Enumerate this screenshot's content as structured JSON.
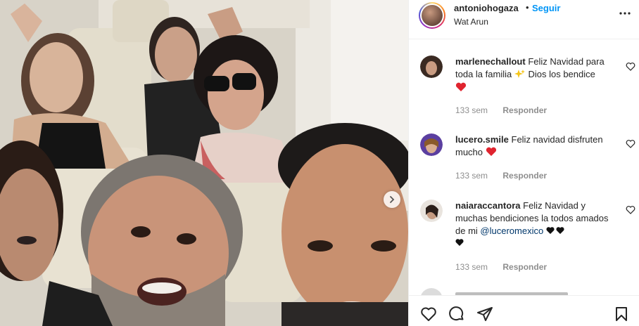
{
  "header": {
    "username": "antoniohogaza",
    "separator": "•",
    "follow_label": "Seguir",
    "location": "Wat Arun"
  },
  "comments": [
    {
      "username": "marlenechallout",
      "text": "Feliz Navidad para toda la familia",
      "emoji_text": "Dios los bendice",
      "time": "133 sem",
      "reply_label": "Responder"
    },
    {
      "username": "lucero.smile",
      "text": "Feliz navidad disfruten mucho",
      "time": "133 sem",
      "reply_label": "Responder"
    },
    {
      "username": "naiaraccantora",
      "text": "Feliz Navidad y muchas bendiciones la todos amados de mi",
      "mention": "@luceromexico",
      "time": "133 sem",
      "reply_label": "Responder"
    }
  ],
  "icons": {
    "more": "more-options-icon",
    "like": "heart-icon",
    "comment": "comment-icon",
    "share": "share-icon",
    "save": "bookmark-icon",
    "next": "chevron-right-icon"
  },
  "colors": {
    "link_blue": "#0095f6",
    "mention": "#00376b",
    "heart_red": "#e0242f",
    "muted": "#8e8e8e"
  }
}
